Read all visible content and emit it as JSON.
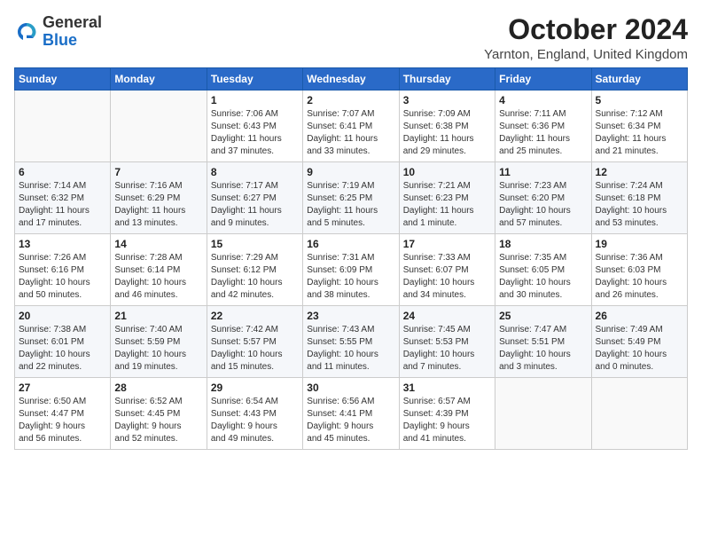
{
  "logo": {
    "line1": "General",
    "line2": "Blue"
  },
  "title": "October 2024",
  "location": "Yarnton, England, United Kingdom",
  "days_of_week": [
    "Sunday",
    "Monday",
    "Tuesday",
    "Wednesday",
    "Thursday",
    "Friday",
    "Saturday"
  ],
  "weeks": [
    [
      {
        "day": "",
        "detail": ""
      },
      {
        "day": "",
        "detail": ""
      },
      {
        "day": "1",
        "detail": "Sunrise: 7:06 AM\nSunset: 6:43 PM\nDaylight: 11 hours\nand 37 minutes."
      },
      {
        "day": "2",
        "detail": "Sunrise: 7:07 AM\nSunset: 6:41 PM\nDaylight: 11 hours\nand 33 minutes."
      },
      {
        "day": "3",
        "detail": "Sunrise: 7:09 AM\nSunset: 6:38 PM\nDaylight: 11 hours\nand 29 minutes."
      },
      {
        "day": "4",
        "detail": "Sunrise: 7:11 AM\nSunset: 6:36 PM\nDaylight: 11 hours\nand 25 minutes."
      },
      {
        "day": "5",
        "detail": "Sunrise: 7:12 AM\nSunset: 6:34 PM\nDaylight: 11 hours\nand 21 minutes."
      }
    ],
    [
      {
        "day": "6",
        "detail": "Sunrise: 7:14 AM\nSunset: 6:32 PM\nDaylight: 11 hours\nand 17 minutes."
      },
      {
        "day": "7",
        "detail": "Sunrise: 7:16 AM\nSunset: 6:29 PM\nDaylight: 11 hours\nand 13 minutes."
      },
      {
        "day": "8",
        "detail": "Sunrise: 7:17 AM\nSunset: 6:27 PM\nDaylight: 11 hours\nand 9 minutes."
      },
      {
        "day": "9",
        "detail": "Sunrise: 7:19 AM\nSunset: 6:25 PM\nDaylight: 11 hours\nand 5 minutes."
      },
      {
        "day": "10",
        "detail": "Sunrise: 7:21 AM\nSunset: 6:23 PM\nDaylight: 11 hours\nand 1 minute."
      },
      {
        "day": "11",
        "detail": "Sunrise: 7:23 AM\nSunset: 6:20 PM\nDaylight: 10 hours\nand 57 minutes."
      },
      {
        "day": "12",
        "detail": "Sunrise: 7:24 AM\nSunset: 6:18 PM\nDaylight: 10 hours\nand 53 minutes."
      }
    ],
    [
      {
        "day": "13",
        "detail": "Sunrise: 7:26 AM\nSunset: 6:16 PM\nDaylight: 10 hours\nand 50 minutes."
      },
      {
        "day": "14",
        "detail": "Sunrise: 7:28 AM\nSunset: 6:14 PM\nDaylight: 10 hours\nand 46 minutes."
      },
      {
        "day": "15",
        "detail": "Sunrise: 7:29 AM\nSunset: 6:12 PM\nDaylight: 10 hours\nand 42 minutes."
      },
      {
        "day": "16",
        "detail": "Sunrise: 7:31 AM\nSunset: 6:09 PM\nDaylight: 10 hours\nand 38 minutes."
      },
      {
        "day": "17",
        "detail": "Sunrise: 7:33 AM\nSunset: 6:07 PM\nDaylight: 10 hours\nand 34 minutes."
      },
      {
        "day": "18",
        "detail": "Sunrise: 7:35 AM\nSunset: 6:05 PM\nDaylight: 10 hours\nand 30 minutes."
      },
      {
        "day": "19",
        "detail": "Sunrise: 7:36 AM\nSunset: 6:03 PM\nDaylight: 10 hours\nand 26 minutes."
      }
    ],
    [
      {
        "day": "20",
        "detail": "Sunrise: 7:38 AM\nSunset: 6:01 PM\nDaylight: 10 hours\nand 22 minutes."
      },
      {
        "day": "21",
        "detail": "Sunrise: 7:40 AM\nSunset: 5:59 PM\nDaylight: 10 hours\nand 19 minutes."
      },
      {
        "day": "22",
        "detail": "Sunrise: 7:42 AM\nSunset: 5:57 PM\nDaylight: 10 hours\nand 15 minutes."
      },
      {
        "day": "23",
        "detail": "Sunrise: 7:43 AM\nSunset: 5:55 PM\nDaylight: 10 hours\nand 11 minutes."
      },
      {
        "day": "24",
        "detail": "Sunrise: 7:45 AM\nSunset: 5:53 PM\nDaylight: 10 hours\nand 7 minutes."
      },
      {
        "day": "25",
        "detail": "Sunrise: 7:47 AM\nSunset: 5:51 PM\nDaylight: 10 hours\nand 3 minutes."
      },
      {
        "day": "26",
        "detail": "Sunrise: 7:49 AM\nSunset: 5:49 PM\nDaylight: 10 hours\nand 0 minutes."
      }
    ],
    [
      {
        "day": "27",
        "detail": "Sunrise: 6:50 AM\nSunset: 4:47 PM\nDaylight: 9 hours\nand 56 minutes."
      },
      {
        "day": "28",
        "detail": "Sunrise: 6:52 AM\nSunset: 4:45 PM\nDaylight: 9 hours\nand 52 minutes."
      },
      {
        "day": "29",
        "detail": "Sunrise: 6:54 AM\nSunset: 4:43 PM\nDaylight: 9 hours\nand 49 minutes."
      },
      {
        "day": "30",
        "detail": "Sunrise: 6:56 AM\nSunset: 4:41 PM\nDaylight: 9 hours\nand 45 minutes."
      },
      {
        "day": "31",
        "detail": "Sunrise: 6:57 AM\nSunset: 4:39 PM\nDaylight: 9 hours\nand 41 minutes."
      },
      {
        "day": "",
        "detail": ""
      },
      {
        "day": "",
        "detail": ""
      }
    ]
  ]
}
